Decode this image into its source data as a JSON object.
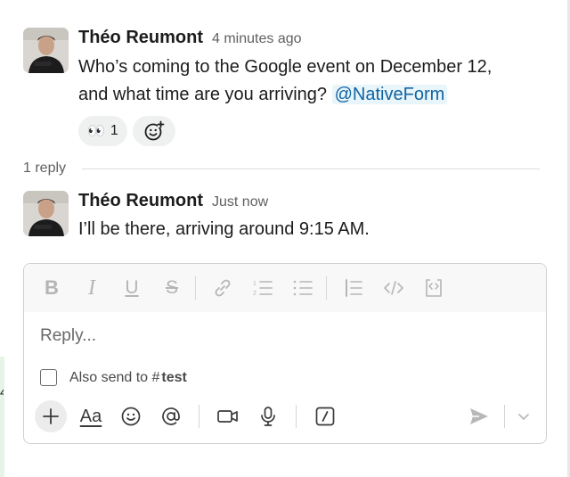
{
  "thread": {
    "parent": {
      "author": "Théo Reumont",
      "time": "4 minutes ago",
      "text_line1": "Who’s coming to the Google event on December 12,",
      "text_line2": "and what time are you arriving?",
      "mention": "@NativeForm",
      "reactions": [
        {
          "emoji": "👀",
          "count": "1"
        }
      ]
    },
    "reply_count": "1 reply",
    "reply": {
      "author": "Théo Reumont",
      "time": "Just now",
      "text": "I’ll be there, arriving around 9:15 AM."
    }
  },
  "composer": {
    "placeholder": "Reply...",
    "also_send_label": "Also send to",
    "channel_hash": "#",
    "channel_name": "test",
    "aa_label": "Aa",
    "formatting_icons": [
      "bold-icon",
      "italic-icon",
      "underline-icon",
      "strikethrough-icon",
      "link-icon",
      "numbered-list-icon",
      "bulleted-list-icon",
      "blockquote-icon",
      "code-icon",
      "code-block-icon"
    ],
    "action_icons": [
      "plus-icon",
      "text-format-icon",
      "emoji-icon",
      "mention-icon",
      "video-icon",
      "microphone-icon",
      "slash-command-icon",
      "send-icon",
      "chevron-down-icon"
    ]
  },
  "colors": {
    "mention_bg": "#e8f5fa",
    "mention_text": "#1264a3",
    "muted_text": "#616061",
    "reaction_bg": "#eff0f0"
  }
}
